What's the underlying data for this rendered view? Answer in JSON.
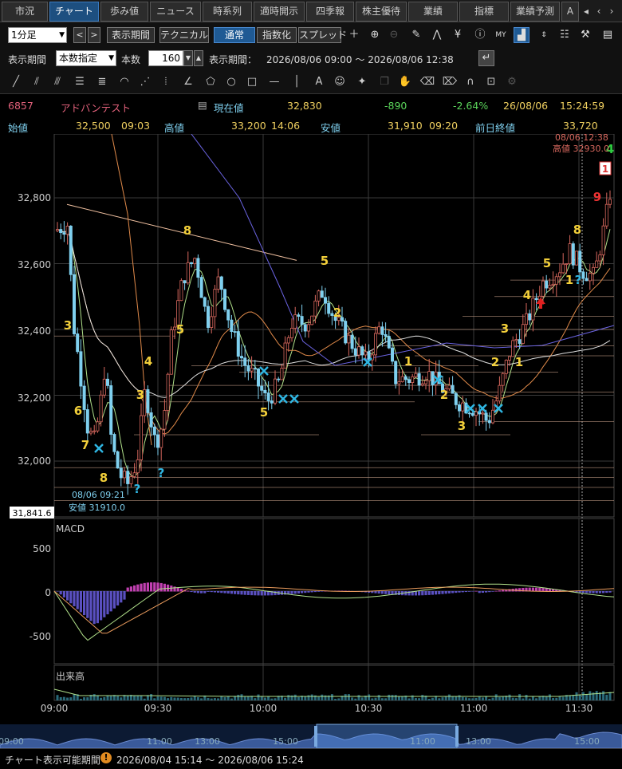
{
  "tabs": [
    "市況",
    "チャート",
    "歩み値",
    "ニュース",
    "時系列",
    "適時開示",
    "四季報",
    "株主優待",
    "業績",
    "指標",
    "業績予測",
    "A"
  ],
  "tab_nav": {
    "left": "‹",
    "right": "›",
    "menu": "◂"
  },
  "toolbar": {
    "period_select": "1分足",
    "display_period": "表示期間",
    "technical": "テクニカル",
    "normal": "通常",
    "index": "指数化",
    "spread": "スプレッド",
    "nav_prev": "<",
    "nav_next": ">"
  },
  "range_bar": {
    "label": "表示期間",
    "mode_select": "本数指定",
    "count_label": "本数",
    "count_value": "160",
    "period_label": "表示期間：",
    "period_value": "2026/08/06 09:00 〜 2026/08/06 12:38"
  },
  "stock": {
    "code": "6857",
    "name": "アドバンテスト",
    "current_label": "現在値",
    "current": "32,830",
    "change": "-890",
    "change_pct": "-2.64%",
    "date": "26/08/06",
    "time": "15:24:59",
    "open_label": "始値",
    "open": "32,500",
    "open_time": "09:03",
    "high_label": "高値",
    "high": "33,200",
    "high_time": "14:06",
    "low_label": "安値",
    "low": "31,910",
    "low_time": "09:20",
    "prev_label": "前日終値",
    "prev": "33,720"
  },
  "colors": {
    "up": "#d8685e",
    "down": "#7fd0ef",
    "tag": "#f2cf3a",
    "cross": "#2fb6e2",
    "macd": "#c040b0",
    "signal": "#e89a5c",
    "ma5": "#b0e08a",
    "ma25": "#e08a4a",
    "ma75": "#e0e0e0",
    "vwap": "#6a63e0"
  },
  "chart": {
    "y_ticks": [
      "32,800",
      "32,600",
      "32,400",
      "32,200",
      "32,000"
    ],
    "current_price_box": "31,841.6",
    "low_annot_line1": "08/06 09:21",
    "low_annot_line2": "安値 31910.0",
    "high_annot_line1": "08/06 12:38",
    "high_annot_line2": "高値 32930.0",
    "macd_label": "MACD",
    "macd_ticks": [
      "500",
      "0",
      "-500"
    ],
    "volume_label": "出来高",
    "x_ticks": [
      "09:00",
      "09:30",
      "10:00",
      "10:30",
      "11:00",
      "11:30"
    ],
    "nav_ticks": [
      "09:00",
      "11:00",
      "13:00",
      "15:00",
      "11:00",
      "13:00",
      "15:00"
    ]
  },
  "marks": [
    {
      "t": "3",
      "x": 85,
      "y": 245,
      "c": "#f2cf3a"
    },
    {
      "t": "6",
      "x": 98,
      "y": 352,
      "c": "#f2cf3a"
    },
    {
      "t": "7",
      "x": 107,
      "y": 395,
      "c": "#f2cf3a"
    },
    {
      "t": "8",
      "x": 130,
      "y": 436,
      "c": "#f2cf3a"
    },
    {
      "t": "?",
      "x": 172,
      "y": 450,
      "c": "#2fb6e2"
    },
    {
      "t": "?",
      "x": 202,
      "y": 430,
      "c": "#2fb6e2"
    },
    {
      "t": "3",
      "x": 176,
      "y": 332,
      "c": "#f2cf3a"
    },
    {
      "t": "4",
      "x": 186,
      "y": 290,
      "c": "#f2cf3a"
    },
    {
      "t": "5",
      "x": 226,
      "y": 250,
      "c": "#f2cf3a"
    },
    {
      "t": "8",
      "x": 235,
      "y": 126,
      "c": "#f2cf3a"
    },
    {
      "t": "5",
      "x": 331,
      "y": 354,
      "c": "#f2cf3a"
    },
    {
      "t": "5",
      "x": 407,
      "y": 164,
      "c": "#f2cf3a"
    },
    {
      "t": "2",
      "x": 423,
      "y": 229,
      "c": "#f2cf3a"
    },
    {
      "t": "1",
      "x": 512,
      "y": 290,
      "c": "#f2cf3a"
    },
    {
      "t": "2",
      "x": 557,
      "y": 332,
      "c": "#f2cf3a"
    },
    {
      "t": "3",
      "x": 579,
      "y": 371,
      "c": "#f2cf3a"
    },
    {
      "t": "2",
      "x": 621,
      "y": 291,
      "c": "#f2cf3a"
    },
    {
      "t": "1",
      "x": 651,
      "y": 291,
      "c": "#f2cf3a"
    },
    {
      "t": "3",
      "x": 633,
      "y": 249,
      "c": "#f2cf3a"
    },
    {
      "t": "4",
      "x": 661,
      "y": 207,
      "c": "#f2cf3a"
    },
    {
      "t": "5",
      "x": 686,
      "y": 167,
      "c": "#f2cf3a"
    },
    {
      "t": "8",
      "x": 724,
      "y": 125,
      "c": "#f2cf3a"
    },
    {
      "t": "1",
      "x": 714,
      "y": 188,
      "c": "#f2cf3a"
    },
    {
      "t": "?",
      "x": 725,
      "y": 188,
      "c": "#2fb6e2"
    },
    {
      "t": "9",
      "x": 749,
      "y": 84,
      "c": "#ee3333"
    },
    {
      "t": "4",
      "x": 765,
      "y": 24,
      "c": "#2ecc40"
    }
  ],
  "crosses": [
    [
      124,
      394
    ],
    [
      331,
      297
    ],
    [
      355,
      332
    ],
    [
      369,
      332
    ],
    [
      461,
      286
    ],
    [
      549,
      308
    ],
    [
      590,
      344
    ],
    [
      605,
      344
    ],
    [
      625,
      344
    ]
  ],
  "footer": {
    "label": "チャート表示可能期間",
    "warn": "!",
    "value": "2026/08/04 15:14 〜 2026/08/06 15:24"
  }
}
